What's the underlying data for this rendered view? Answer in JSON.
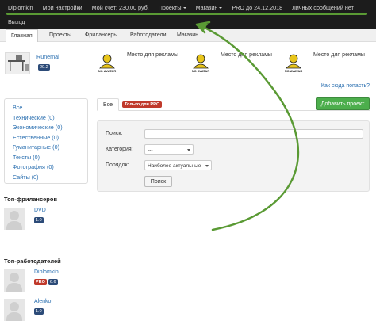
{
  "topnav": {
    "user": "Diplomkin",
    "settings": "Мои настройки",
    "balance": "Мой счет: 230.00 руб.",
    "projects": "Проекты",
    "shop": "Магазин",
    "pro_until": "PRO до 24.12.2018",
    "messages": "Личных сообщений нет",
    "logout": "Выход"
  },
  "subnav": {
    "tabs": [
      "Главная",
      "Проекты",
      "Фрилансеры",
      "Работодатели",
      "Магазин"
    ]
  },
  "ads": {
    "first_name": "Runemal",
    "first_badge": "20.2",
    "slot_text": "Место для рекламы",
    "slot_avatar_label": "NO AVATAR",
    "how_link": "Как сюда попасть?"
  },
  "categories": [
    "Все",
    "Технические (0)",
    "Экономические (0)",
    "Естественные (0)",
    "Гуманитарные (0)",
    "Тексты (0)",
    "Фотография (0)",
    "Сайты (0)"
  ],
  "top_freelancers": {
    "title": "Топ-фрилансеров",
    "items": [
      {
        "name": "DVD",
        "badge": "1.0"
      }
    ]
  },
  "top_employers": {
    "title": "Топ-работодателей",
    "items": [
      {
        "name": "Diplomkin",
        "pro": "PRO",
        "badge": "6.6"
      },
      {
        "name": "Alenko",
        "badge": "1.0"
      }
    ]
  },
  "main": {
    "tab_all": "Все",
    "tab_pro": "Только для PRO",
    "add_button": "Добавить проект",
    "search_label": "Поиск:",
    "category_label": "Категория:",
    "category_value": "---",
    "order_label": "Порядок:",
    "order_value": "Наиболее актуальные",
    "search_button": "Поиск"
  },
  "colors": {
    "arrow": "#5a9a34",
    "topbar": "#1c1c1c",
    "link": "#2a6fb0",
    "add_button": "#4cae4c",
    "pro_badge": "#c0392b"
  }
}
